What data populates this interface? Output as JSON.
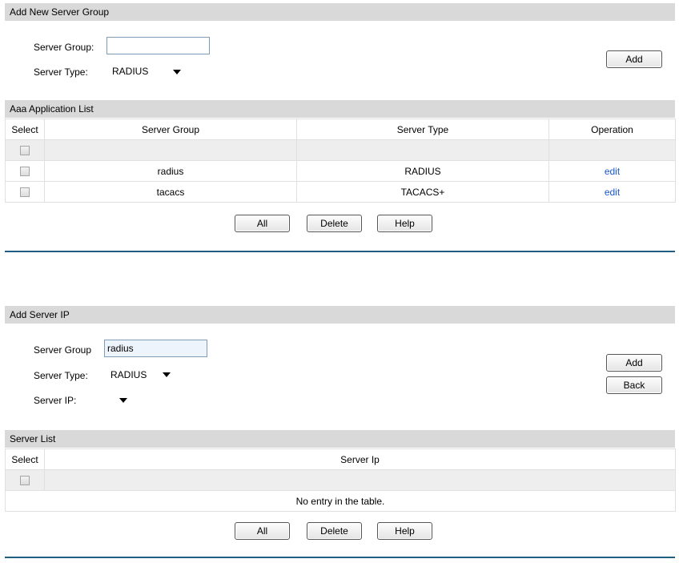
{
  "add_group": {
    "title": "Add New Server Group",
    "server_group_label": "Server Group:",
    "server_group_value": "",
    "server_type_label": "Server Type:",
    "server_type_value": "RADIUS",
    "add_label": "Add"
  },
  "app_list": {
    "title": "Aaa Application List",
    "columns": [
      "Select",
      "Server Group",
      "Server Type",
      "Operation"
    ],
    "rows": [
      {
        "group": "radius",
        "type": "RADIUS",
        "op": "edit"
      },
      {
        "group": "tacacs",
        "type": "TACACS+",
        "op": "edit"
      }
    ],
    "all_label": "All",
    "delete_label": "Delete",
    "help_label": "Help"
  },
  "add_ip": {
    "title": "Add Server IP",
    "server_group_label": "Server Group",
    "server_group_value": "radius",
    "server_type_label": "Server Type:",
    "server_type_value": "RADIUS",
    "server_ip_label": "Server IP:",
    "server_ip_value": "",
    "add_label": "Add",
    "back_label": "Back"
  },
  "server_list": {
    "title": "Server List",
    "columns": [
      "Select",
      "Server Ip"
    ],
    "empty_text": "No entry in the table.",
    "all_label": "All",
    "delete_label": "Delete",
    "help_label": "Help"
  },
  "colors": {
    "header_bar": "#d9d9d9",
    "link": "#1a57c9",
    "divider": "#1f5e7f"
  }
}
